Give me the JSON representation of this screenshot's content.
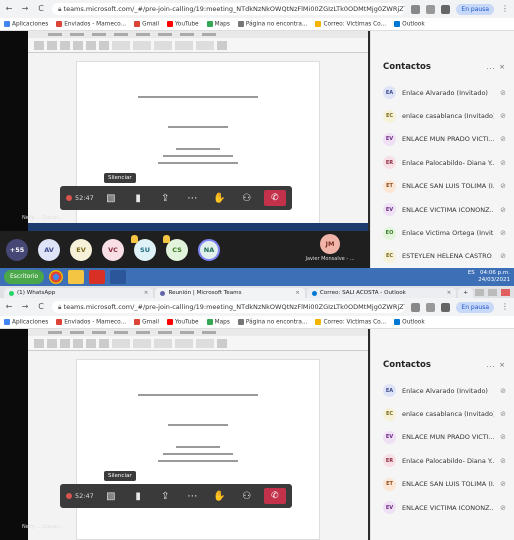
{
  "browser": {
    "url": "teams.microsoft.com/_#/pre-join-calling/19:meeting_NTdkNzNkOWQtNzFlMi00ZGIzLTk0ODMtMjg0ZWRjZTA0...",
    "paused_label": "En pausa",
    "bookmarks": [
      {
        "label": "Aplicaciones",
        "color": "#4285f4"
      },
      {
        "label": "Enviados - Mameco...",
        "color": "#db4437"
      },
      {
        "label": "Gmail",
        "color": "#db4437"
      },
      {
        "label": "YouTube",
        "color": "#ff0000"
      },
      {
        "label": "Maps",
        "color": "#34a853"
      },
      {
        "label": "Página no encontra...",
        "color": "#777777"
      },
      {
        "label": "Correo: Victimas Co...",
        "color": "#f4b400"
      },
      {
        "label": "Outlook",
        "color": "#0078d4"
      }
    ]
  },
  "call": {
    "timer": "52:47",
    "tooltip": "Silenciar",
    "presenter": "Nelly ... Cucun..."
  },
  "participants": {
    "more": "+55",
    "items": [
      {
        "initials": "AV",
        "bg": "#dfe3f7",
        "fg": "#3b4a8a",
        "hand": false,
        "active": false
      },
      {
        "initials": "EV",
        "bg": "#f6f1d9",
        "fg": "#7a6a1a",
        "hand": false,
        "active": false
      },
      {
        "initials": "VC",
        "bg": "#f8dfe5",
        "fg": "#8a2a40",
        "hand": false,
        "active": false
      },
      {
        "initials": "SU",
        "bg": "#dff2f7",
        "fg": "#1e6a80",
        "hand": true,
        "active": false
      },
      {
        "initials": "CS",
        "bg": "#e3f4dc",
        "fg": "#3a7a24",
        "hand": true,
        "active": false
      },
      {
        "initials": "NA",
        "bg": "#e2f0ec",
        "fg": "#1f6a5a",
        "hand": false,
        "active": true
      }
    ],
    "speaker": {
      "initials": "JM",
      "name": "Javier Monsalve - ..."
    }
  },
  "contacts": {
    "title": "Contactos",
    "actions": "...",
    "close": "×",
    "list_top": [
      {
        "initials": "EA",
        "name": "Enlace Alvarado (Invitado)",
        "bg": "#dfe3f7",
        "fg": "#3b4a8a"
      },
      {
        "initials": "EC",
        "name": "enlace casablanca (Invitado)",
        "bg": "#f6f1d9",
        "fg": "#7a6a1a"
      },
      {
        "initials": "EV",
        "name": "ENLACE MUN PRADO VICTI...",
        "bg": "#efe0f5",
        "fg": "#6a2a80"
      },
      {
        "initials": "ER",
        "name": "Enlace Palocabildo- Diana Y...",
        "bg": "#f8dfe5",
        "fg": "#8a2a40"
      },
      {
        "initials": "ET",
        "name": "ENLACE SAN LUIS TOLIMA (I...",
        "bg": "#fce7d6",
        "fg": "#8a4a1a"
      },
      {
        "initials": "EV",
        "name": "ENLACE VICTIMA ICONONZ...",
        "bg": "#efe0f5",
        "fg": "#6a2a80"
      },
      {
        "initials": "EO",
        "name": "Enlace Victima Ortega (Invit...",
        "bg": "#e3f4dc",
        "fg": "#3a7a24"
      },
      {
        "initials": "EC",
        "name": "ESTEYLEN HELENA CASTRO ...",
        "bg": "#f6f1d9",
        "fg": "#7a6a1a"
      }
    ],
    "list_bottom": [
      {
        "initials": "EA",
        "name": "Enlace Alvarado (Invitado)",
        "bg": "#dfe3f7",
        "fg": "#3b4a8a"
      },
      {
        "initials": "EC",
        "name": "enlace casablanca (Invitado)",
        "bg": "#f6f1d9",
        "fg": "#7a6a1a"
      },
      {
        "initials": "EV",
        "name": "ENLACE MUN PRADO VICTI...",
        "bg": "#efe0f5",
        "fg": "#6a2a80"
      },
      {
        "initials": "ER",
        "name": "Enlace Palocabildo- Diana Y...",
        "bg": "#f8dfe5",
        "fg": "#8a2a40"
      },
      {
        "initials": "ET",
        "name": "ENLACE SAN LUIS TOLIMA (I...",
        "bg": "#fce7d6",
        "fg": "#8a4a1a"
      },
      {
        "initials": "EV",
        "name": "ENLACE VICTIMA ICONONZ...",
        "bg": "#efe0f5",
        "fg": "#6a2a80"
      }
    ]
  },
  "windows_taskbar": {
    "start_label": "Escritorio",
    "time": "04:06 p.m.",
    "date": "24/03/2021",
    "lang": "ES"
  },
  "browser_tabs": [
    {
      "label": "(1) WhatsApp",
      "color": "#25d366",
      "active": false
    },
    {
      "label": "Reunión | Microsoft Teams",
      "color": "#6264a7",
      "active": true
    },
    {
      "label": "Correo: SALI ACOSTA - Outlook",
      "color": "#0078d4",
      "active": false
    }
  ],
  "colors": {
    "teams_purple": "#6264a7",
    "hangup_red": "#c4314b"
  }
}
